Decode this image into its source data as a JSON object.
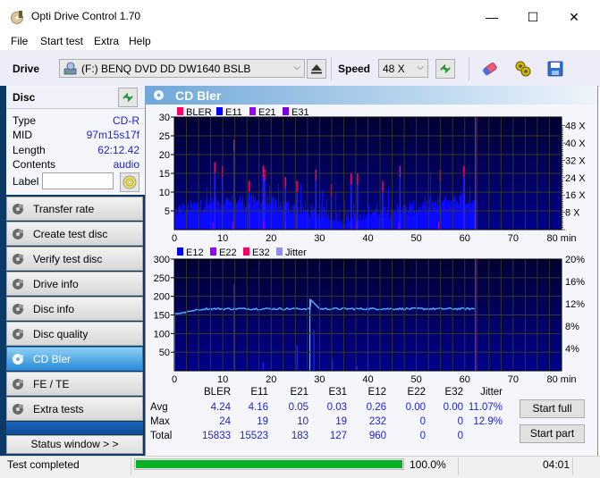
{
  "window": {
    "title": "Opti Drive Control 1.70",
    "controls": {
      "minimize": "—",
      "maximize": "☐",
      "close": "✕"
    }
  },
  "menu": [
    "File",
    "Start test",
    "Extra",
    "Help"
  ],
  "toolbar": {
    "drive_label": "Drive",
    "drive_value": "(F:)   BENQ DVD DD DW1640 BSLB",
    "speed_label": "Speed",
    "speed_value": "48 X",
    "icons": [
      "eject-icon",
      "refresh-icon",
      "erase-icon",
      "settings-icon",
      "save-icon"
    ]
  },
  "disc": {
    "header": "Disc",
    "fields": [
      {
        "key": "Type",
        "value": "CD-R"
      },
      {
        "key": "MID",
        "value": "97m15s17f"
      },
      {
        "key": "Length",
        "value": "62:12.42"
      },
      {
        "key": "Contents",
        "value": "audio"
      }
    ],
    "label_key": "Label",
    "label_value": ""
  },
  "nav": [
    {
      "label": "Transfer rate",
      "active": false
    },
    {
      "label": "Create test disc",
      "active": false
    },
    {
      "label": "Verify test disc",
      "active": false
    },
    {
      "label": "Drive info",
      "active": false
    },
    {
      "label": "Disc info",
      "active": false
    },
    {
      "label": "Disc quality",
      "active": false
    },
    {
      "label": "CD Bler",
      "active": true
    },
    {
      "label": "FE / TE",
      "active": false
    },
    {
      "label": "Extra tests",
      "active": false
    }
  ],
  "status_window_label": "Status window > >",
  "panel_title": "CD Bler",
  "chart_data": [
    {
      "type": "bar",
      "title": "CD Bler - BLER/E11/E21/E31",
      "legend": [
        {
          "name": "BLER",
          "color": "#ff0066"
        },
        {
          "name": "E11",
          "color": "#0000ff"
        },
        {
          "name": "E21",
          "color": "#9900ff"
        },
        {
          "name": "E31",
          "color": "#7a00e6"
        }
      ],
      "legend_placement": "top-left",
      "xlabel": "min",
      "xlim": [
        0,
        80
      ],
      "x_ticks": [
        0,
        10,
        20,
        30,
        40,
        50,
        60,
        70,
        "80 min"
      ],
      "ylim": [
        0,
        30
      ],
      "y_ticks": [
        5,
        10,
        15,
        20,
        25,
        30
      ],
      "y2_ticks": [
        "8 X",
        "16 X",
        "24 X",
        "32 X",
        "40 X",
        "48 X"
      ],
      "y2_range_x": [
        0,
        48
      ],
      "end_marker_min": 62.2,
      "grid": true,
      "series_summary": {
        "BLER": {
          "avg": 4.24,
          "max": 24
        },
        "E11": {
          "avg": 4.16,
          "max": 19
        },
        "E21": {
          "avg": 0.05,
          "max": 10
        },
        "E31": {
          "avg": 0.03,
          "max": 19
        }
      },
      "bler_peaks": [
        {
          "x": 8.2,
          "y": 18
        },
        {
          "x": 9.8,
          "y": 17
        },
        {
          "x": 12.2,
          "y": 24
        },
        {
          "x": 15.3,
          "y": 13
        },
        {
          "x": 18.2,
          "y": 17
        },
        {
          "x": 18.5,
          "y": 16
        },
        {
          "x": 22.8,
          "y": 14
        },
        {
          "x": 25.2,
          "y": 13
        },
        {
          "x": 29.1,
          "y": 16
        },
        {
          "x": 32.3,
          "y": 12
        },
        {
          "x": 36.4,
          "y": 15
        },
        {
          "x": 37.7,
          "y": 15
        },
        {
          "x": 42.9,
          "y": 13
        },
        {
          "x": 46.5,
          "y": 17
        },
        {
          "x": 54.8,
          "y": 16
        },
        {
          "x": 59.7,
          "y": 17
        }
      ]
    },
    {
      "type": "bar",
      "title": "CD Bler - E12/E22/E32/Jitter",
      "legend": [
        {
          "name": "E12",
          "color": "#0000ff"
        },
        {
          "name": "E22",
          "color": "#9900ff"
        },
        {
          "name": "E32",
          "color": "#ff0066"
        },
        {
          "name": "Jitter",
          "color": "#8c8cff"
        }
      ],
      "legend_placement": "top-left",
      "xlabel": "min",
      "xlim": [
        0,
        80
      ],
      "x_ticks": [
        0,
        10,
        20,
        30,
        40,
        50,
        60,
        70,
        "80 min"
      ],
      "ylim": [
        0,
        300
      ],
      "y_ticks": [
        50,
        100,
        150,
        200,
        250,
        300
      ],
      "y2_ticks": [
        "4%",
        "8%",
        "12%",
        "16%",
        "20%"
      ],
      "y2_range_pct": [
        0,
        20
      ],
      "end_marker_min": 62.2,
      "grid": true,
      "e12_spikes": [
        {
          "x": 12.2,
          "y": 232
        },
        {
          "x": 18.2,
          "y": 22
        },
        {
          "x": 25.2,
          "y": 68
        },
        {
          "x": 28.7,
          "y": 108
        },
        {
          "x": 32.5,
          "y": 30
        },
        {
          "x": 37.6,
          "y": 12
        }
      ],
      "jitter_pct": {
        "start": 10.2,
        "typical": 11.1,
        "peak_x": 28.0,
        "peak": 12.9,
        "end_x": 62.2
      }
    }
  ],
  "stats": {
    "columns": [
      "BLER",
      "E11",
      "E21",
      "E31",
      "E12",
      "E22",
      "E32",
      "Jitter"
    ],
    "rows": [
      {
        "label": "Avg",
        "values": [
          "4.24",
          "4.16",
          "0.05",
          "0.03",
          "0.26",
          "0.00",
          "0.00",
          "11.07%"
        ]
      },
      {
        "label": "Max",
        "values": [
          "24",
          "19",
          "10",
          "19",
          "232",
          "0",
          "0",
          "12.9%"
        ]
      },
      {
        "label": "Total",
        "values": [
          "15833",
          "15523",
          "183",
          "127",
          "960",
          "0",
          "0",
          ""
        ]
      }
    ]
  },
  "buttons": {
    "start_full": "Start full",
    "start_part": "Start part"
  },
  "statusbar": {
    "text": "Test completed",
    "progress": 100.0,
    "progress_label": "100.0%",
    "time": "04:01"
  }
}
